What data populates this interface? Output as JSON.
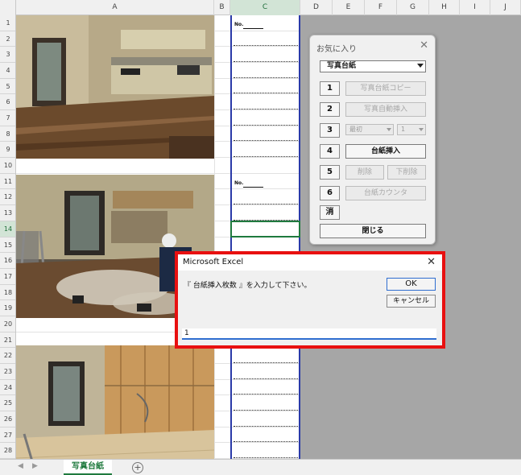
{
  "columns": [
    "A",
    "B",
    "C",
    "D",
    "E",
    "F",
    "G",
    "H",
    "I",
    "J"
  ],
  "rows": [
    "1",
    "2",
    "3",
    "4",
    "5",
    "6",
    "7",
    "8",
    "9",
    "10",
    "11",
    "12",
    "13",
    "14",
    "15",
    "16",
    "17",
    "18",
    "19",
    "20",
    "21",
    "22",
    "23",
    "24",
    "25",
    "26",
    "27",
    "28"
  ],
  "active_row": "14",
  "active_column": "C",
  "sheet": {
    "no_label": "No."
  },
  "favorites": {
    "title": "お気に入り",
    "combo_value": "写真台紙",
    "buttons": [
      {
        "num": "1",
        "label": "写真台紙コピー"
      },
      {
        "num": "2",
        "label": "写真自動挿入"
      },
      {
        "num": "3",
        "combo_a": "最初",
        "combo_b": "1"
      },
      {
        "num": "4",
        "label": "台紙挿入"
      },
      {
        "num": "5",
        "label_a": "削除",
        "label_b": "下削除"
      },
      {
        "num": "6",
        "label": "台紙カウンタ"
      },
      {
        "num": "消"
      }
    ],
    "close_label": "閉じる"
  },
  "dialog": {
    "title": "Microsoft Excel",
    "message": "『 台紙挿入枚数 』を入力して下さい。",
    "ok_label": "OK",
    "cancel_label": "キャンセル",
    "input_value": "1"
  },
  "tabs": {
    "sheet_name": "写真台紙",
    "add_label": "+",
    "nav_prev": "◀",
    "nav_next": "▶"
  },
  "colors": {
    "accent_green": "#1f7a3e",
    "dialog_highlight": "#e81010",
    "column_border": "#2a3aa8"
  }
}
